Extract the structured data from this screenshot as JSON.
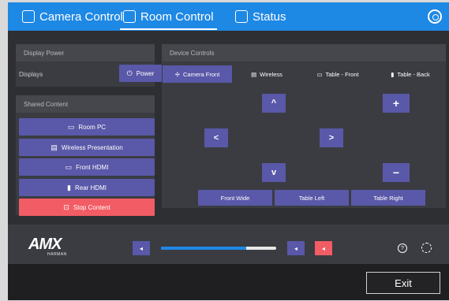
{
  "nav": {
    "tabs": [
      {
        "label": "Camera Control",
        "icon": "camera-icon"
      },
      {
        "label": "Room Control",
        "icon": "room-icon",
        "active": true
      },
      {
        "label": "Status",
        "icon": "pulse-icon"
      }
    ],
    "settings_icon": "gear-icon"
  },
  "display_power": {
    "title": "Display Power",
    "row_label": "Displays",
    "power_label": "Power"
  },
  "shared_content": {
    "title": "Shared Content",
    "buttons": [
      {
        "label": "Room PC",
        "glyph": "▭"
      },
      {
        "label": "Wireless Presentation",
        "glyph": "▤"
      },
      {
        "label": "Front HDMI",
        "glyph": "▭"
      },
      {
        "label": "Rear HDMI",
        "glyph": "▮"
      },
      {
        "label": "Stop Content",
        "glyph": "⊡"
      }
    ]
  },
  "device_controls": {
    "title": "Device Controls",
    "tabs": [
      {
        "label": "Camera Front",
        "glyph": "✢",
        "active": true
      },
      {
        "label": "Wireless",
        "glyph": "▤"
      },
      {
        "label": "Table - Front",
        "glyph": "▭"
      },
      {
        "label": "Table - Back",
        "glyph": "▮"
      }
    ],
    "controls": {
      "up": "^",
      "down": "v",
      "left": "<",
      "right": ">",
      "zoom_in": "+",
      "zoom_out": "−"
    },
    "presets": [
      "Front Wide",
      "Table Left",
      "Table Right"
    ]
  },
  "bottom": {
    "logo": "AMX",
    "logo_sub": "HARMAN",
    "volume_down_glyph": "◂",
    "volume_up_glyph": "◂",
    "mute_glyph": "◂",
    "volume_level_pct": 74,
    "help_glyph": "?"
  },
  "footer": {
    "exit_label": "Exit"
  },
  "colors": {
    "accent": "#1e88e5",
    "button": "#5a58a8",
    "danger": "#f25c64",
    "panel": "#3a3c42",
    "background": "#2e2f33"
  }
}
